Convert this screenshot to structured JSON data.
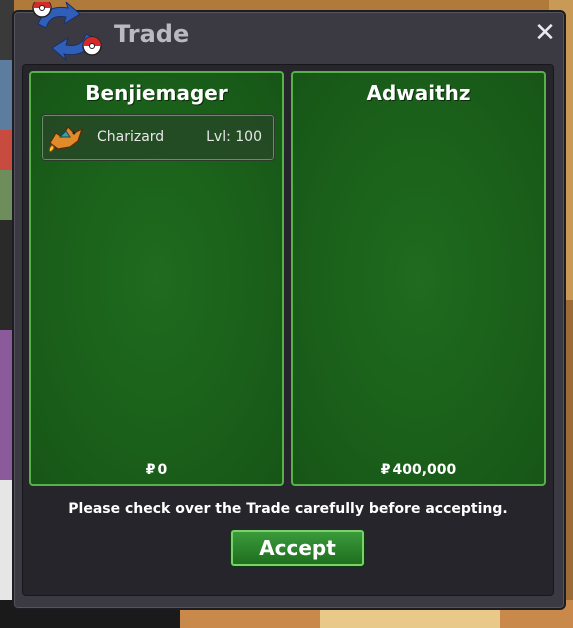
{
  "window": {
    "title": "Trade",
    "close_label": "✕"
  },
  "left_panel": {
    "player": "Benjiemager",
    "items": [
      {
        "name": "Charizard",
        "level": "Lvl: 100",
        "icon": "charizard-sprite-icon"
      }
    ],
    "money_symbol": "₽",
    "money": "0"
  },
  "right_panel": {
    "player": "Adwaithz",
    "money_symbol": "₽",
    "money": "400,000"
  },
  "footer": {
    "notice": "Please check over the Trade carefully before accepting.",
    "accept_label": "Accept"
  },
  "colors": {
    "panel_green": "#1a5f1a",
    "panel_border": "#58b04a",
    "window_bg": "#3b3a42"
  }
}
